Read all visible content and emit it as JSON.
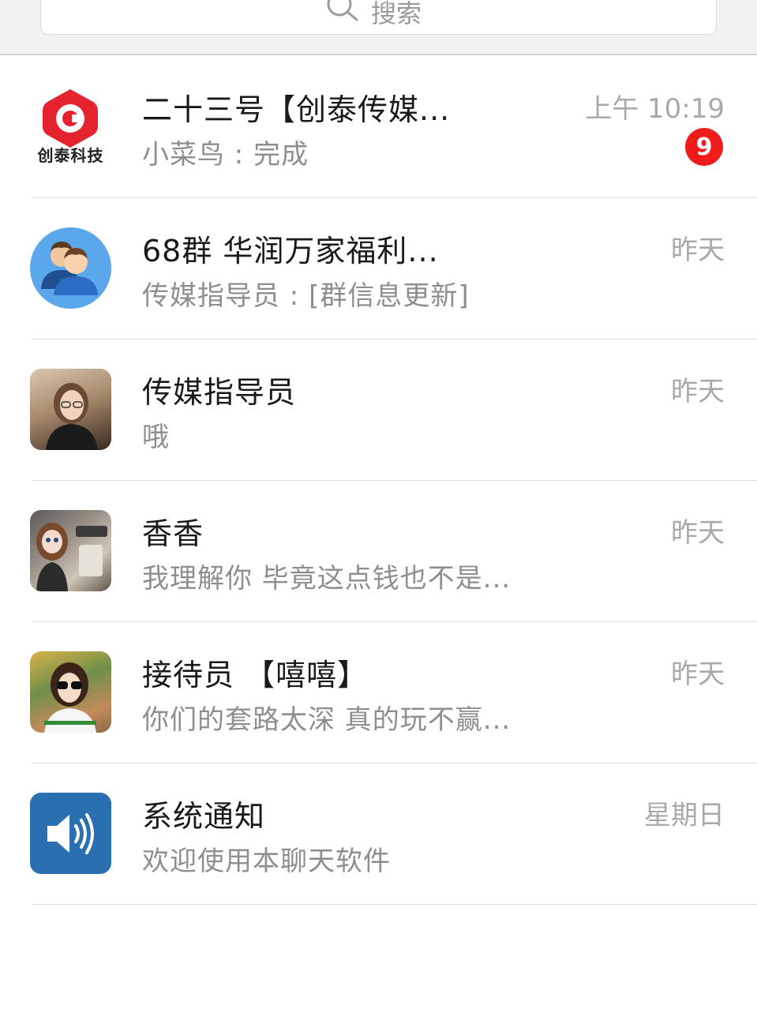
{
  "search": {
    "placeholder": "搜索",
    "icon": "search-icon"
  },
  "chats": [
    {
      "name": "二十三号【创泰传媒...",
      "preview": "小菜鸟 : 完成",
      "time": "上午 10:19",
      "unread": "9",
      "avatar": "company-logo",
      "avatar_label": "创泰科技"
    },
    {
      "name": "68群  华润万家福利...",
      "preview": "传媒指导员 : [群信息更新]",
      "time": "昨天",
      "avatar": "group-icon"
    },
    {
      "name": "传媒指导员",
      "preview": "哦",
      "time": "昨天",
      "avatar": "user-photo"
    },
    {
      "name": "香香",
      "preview": "我理解你 毕竟这点钱也不是...",
      "time": "昨天",
      "avatar": "doll-photo"
    },
    {
      "name": "接待员 【嘻嘻】",
      "preview": "你们的套路太深 真的玩不赢...",
      "time": "昨天",
      "avatar": "user-photo"
    },
    {
      "name": "系统通知",
      "preview": "欢迎使用本聊天软件",
      "time": "星期日",
      "avatar": "speaker-icon"
    }
  ],
  "colors": {
    "badge": "#f01b1b",
    "system_icon_bg": "#2a6fb0",
    "group_icon_bg": "#5aa7ec",
    "logo_red": "#e5232f"
  }
}
